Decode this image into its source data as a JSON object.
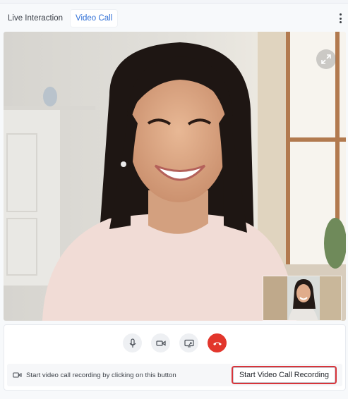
{
  "tabs": [
    {
      "label": "Live Interaction",
      "active": false
    },
    {
      "label": "Video Call",
      "active": true
    }
  ],
  "video": {
    "expand_icon": "expand-icon",
    "pip_present": true
  },
  "controls": {
    "mic_icon": "microphone-icon",
    "camera_icon": "video-camera-icon",
    "screen_share_icon": "screen-share-icon",
    "end_call_icon": "end-call-icon"
  },
  "recording": {
    "hint": "Start video call recording by clicking on this button",
    "button_label": "Start Video Call Recording"
  },
  "colors": {
    "accent": "#2f6fd6",
    "end_call": "#e2362c",
    "highlight_border": "#d8343a"
  }
}
